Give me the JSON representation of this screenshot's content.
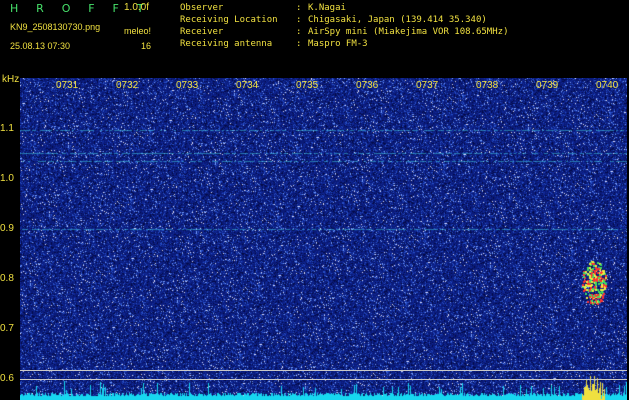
{
  "header": {
    "brand": "H R O F F T",
    "version": "1.0.0f",
    "filename": "KN9_2508130730.png",
    "timestamp": "25.08.13 07:30",
    "meleo_label": "meleo!",
    "meleo_value": "16",
    "info": [
      {
        "key": "Observer",
        "value": "K.Nagai"
      },
      {
        "key": "Receiving Location",
        "value": "Chigasaki, Japan (139.414 35.340)"
      },
      {
        "key": "Receiver",
        "value": "AirSpy mini (Miakejima VOR 108.65MHz)"
      },
      {
        "key": "Receiving antenna",
        "value": "Maspro FM-3"
      }
    ],
    "info_separator": ":"
  },
  "axis": {
    "unit": "kHz",
    "y_ticks": [
      "1.1",
      "1.0",
      "0.9",
      "0.8",
      "0.7",
      "0.6"
    ],
    "x_ticks": [
      "0731",
      "0732",
      "0733",
      "0734",
      "0735",
      "0736",
      "0737",
      "0738",
      "0739",
      "0740"
    ]
  },
  "colors": {
    "background": "#000000",
    "noise_base": "#0a1a78",
    "text": "#f0e040",
    "brand": "#46e06a",
    "bottom_band": "#17d7f0",
    "echo": "#ff3030"
  }
}
